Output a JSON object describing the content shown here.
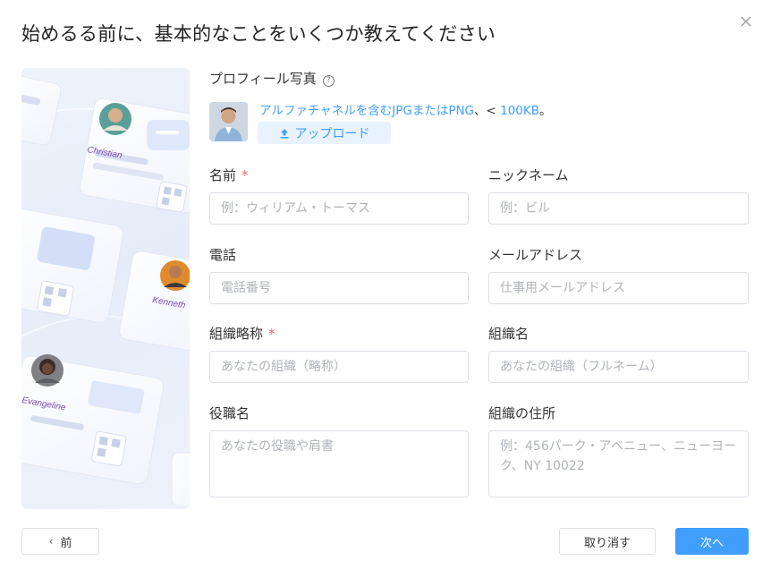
{
  "dialog": {
    "title": "始めるる前に、基本的なことをいくつか教えてください",
    "close_icon": "close-icon"
  },
  "illustration": {
    "names": [
      "Christian",
      "Kenneth",
      "Evangeline"
    ]
  },
  "profile_photo": {
    "label": "プロフィール写真",
    "help_glyph": "?",
    "hint_link": "アルファチャネルを含むJPGまたはPNG",
    "hint_sep": "、< ",
    "hint_size": "100KB",
    "hint_end": "。",
    "upload_label": "アップロード"
  },
  "form": {
    "name": {
      "label": "名前",
      "required": "*",
      "placeholder": "例：ウィリアム・トーマス"
    },
    "nickname": {
      "label": "ニックネーム",
      "placeholder": "例：ビル"
    },
    "phone": {
      "label": "電話",
      "placeholder": "電話番号"
    },
    "email": {
      "label": "メールアドレス",
      "placeholder": "仕事用メールアドレス"
    },
    "org_short": {
      "label": "組織略称",
      "required": "*",
      "placeholder": "あなたの組織（略称）"
    },
    "org_name": {
      "label": "組織名",
      "placeholder": "あなたの組織（フルネーム）"
    },
    "job_title": {
      "label": "役職名",
      "placeholder": "あなたの役職や肩書"
    },
    "org_address": {
      "label": "組織の住所",
      "placeholder": "例：456パーク・アベニュー、ニューヨーク、NY 10022"
    }
  },
  "footer": {
    "prev_label": "前",
    "cancel_label": "取り消す",
    "next_label": "次へ"
  },
  "colors": {
    "accent": "#409eff",
    "required": "#f56c6c",
    "upload_bg": "#e8f3ff"
  }
}
